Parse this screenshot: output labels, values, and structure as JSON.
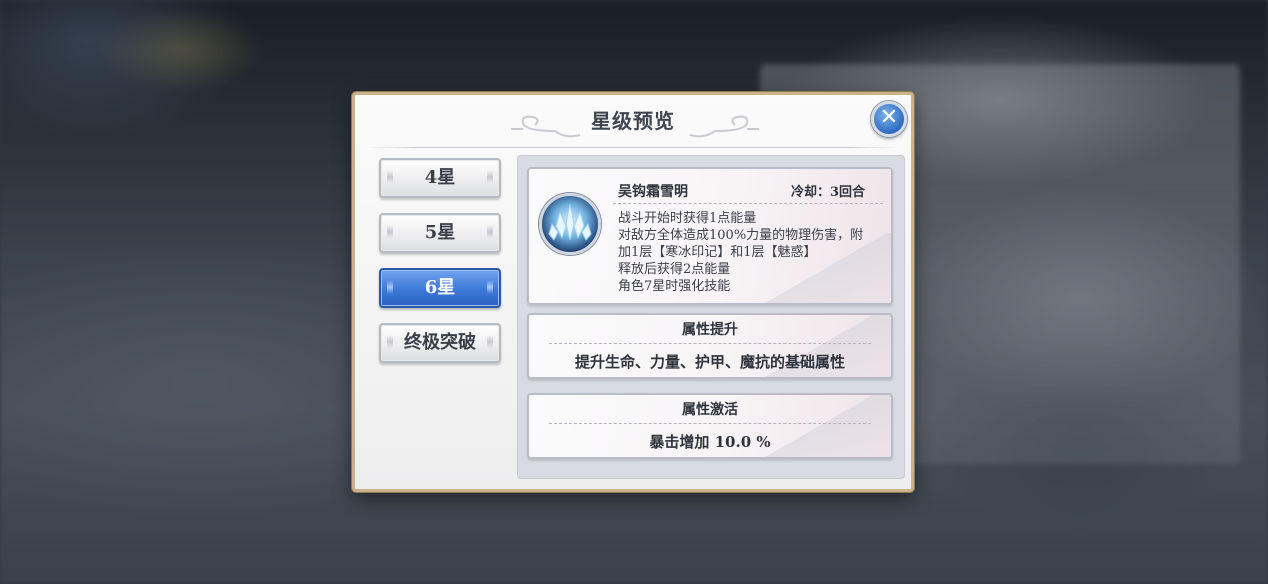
{
  "dialog": {
    "title": "星级预览",
    "close_label": "✕"
  },
  "tabs": [
    {
      "label": "4星",
      "active": false
    },
    {
      "label": "5星",
      "active": false
    },
    {
      "label": "6星",
      "active": true
    },
    {
      "label": "终极突破",
      "active": false
    }
  ],
  "skill": {
    "name": "吴钩霜雪明",
    "cooldown": "冷却：3回合",
    "icon": "ice-crystal-skill-icon",
    "description": [
      "战斗开始时获得1点能量",
      "对敌方全体造成100%力量的物理伤害，附",
      "加1层【寒冰印记】和1层【魅惑】",
      "释放后获得2点能量",
      "角色7星时强化技能"
    ]
  },
  "attribute_boost": {
    "title": "属性提升",
    "text": "提升生命、力量、护甲、魔抗的基础属性"
  },
  "attribute_activation": {
    "title": "属性激活",
    "text": "暴击增加 10.0 %"
  },
  "colors": {
    "active_tab": "#3e79d8",
    "frame_gold": "#c9b48a",
    "close_button": "#2f6cc0"
  }
}
